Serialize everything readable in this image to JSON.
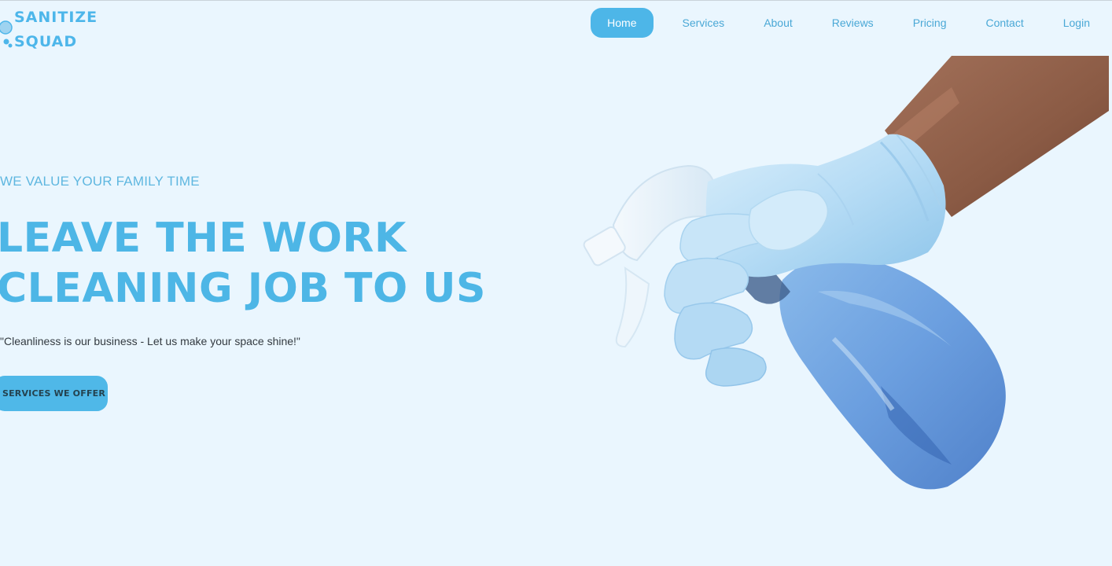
{
  "brand": {
    "line1": "SANITIZE",
    "line2": "SQUAD",
    "logo_icon": "water-drops-icon",
    "color": "#4db6ea"
  },
  "nav": {
    "items": [
      {
        "label": "Home",
        "active": true
      },
      {
        "label": "Services",
        "active": false
      },
      {
        "label": "About",
        "active": false
      },
      {
        "label": "Reviews",
        "active": false
      },
      {
        "label": "Pricing",
        "active": false
      },
      {
        "label": "Contact",
        "active": false
      },
      {
        "label": "Login",
        "active": false
      }
    ]
  },
  "hero": {
    "eyebrow": "WE VALUE YOUR FAMILY TIME",
    "headline_line1": "LEAVE THE WORK",
    "headline_line2": "CLEANING JOB TO US",
    "tagline": "\"Cleanliness is our business - Let us make your space shine!\"",
    "cta_label": "SERVICES WE OFFER",
    "image": "gloved-hand-spray-bottle-illustration"
  },
  "colors": {
    "background": "#eaf6fe",
    "accent": "#4db6e8",
    "nav_text": "#4aa8d6",
    "body_text": "#333a40"
  }
}
